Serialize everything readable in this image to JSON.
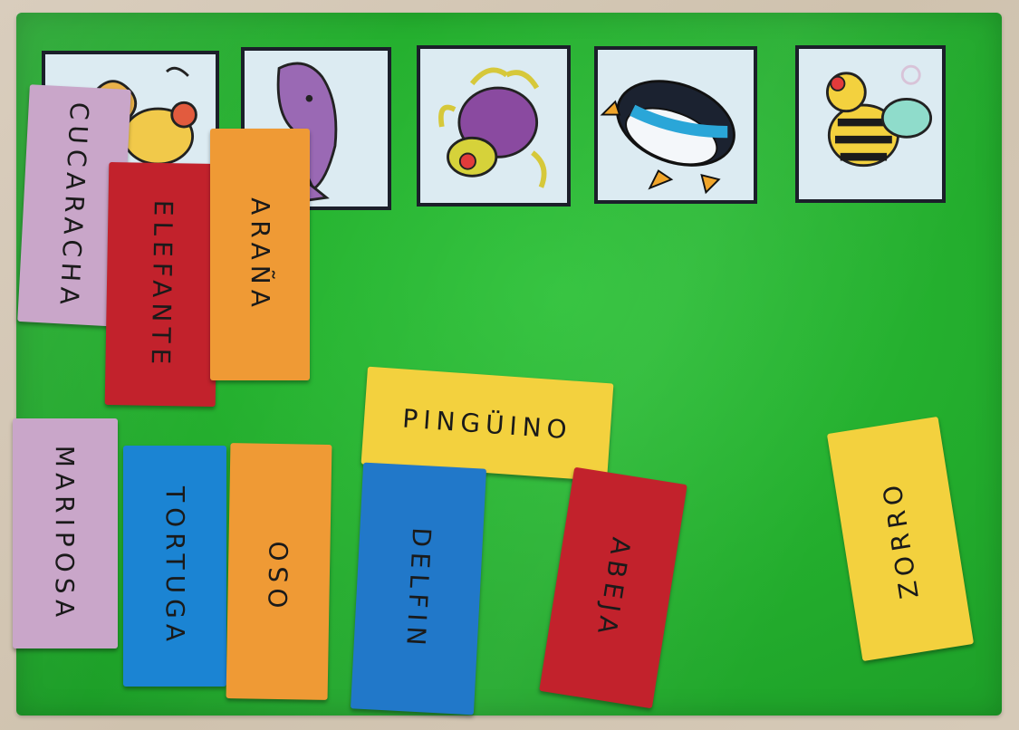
{
  "scene": {
    "board_color": "#22ad2d",
    "table_color": "#d6cab8"
  },
  "pictures": [
    {
      "icon": "cockroach-icon"
    },
    {
      "icon": "dolphin-icon"
    },
    {
      "icon": "spider-icon"
    },
    {
      "icon": "penguin-icon"
    },
    {
      "icon": "bee-icon"
    }
  ],
  "cards": {
    "cucaracha": "CUCARACHA",
    "elefante": "ELEFANTE",
    "arana": "ARAÑA",
    "pinguino": "PINGÜINO",
    "mariposa": "MARIPOSA",
    "tortuga": "TORTUGA",
    "oso": "OSO",
    "delfin": "DELFIN",
    "abeja": "ABEJA",
    "zorro": "ZORRO"
  },
  "card_colors": {
    "lilac": "#c9a6c9",
    "red": "#c2222c",
    "orange": "#ef9a35",
    "blue": "#1b84d3",
    "yellow": "#f3d13e"
  }
}
